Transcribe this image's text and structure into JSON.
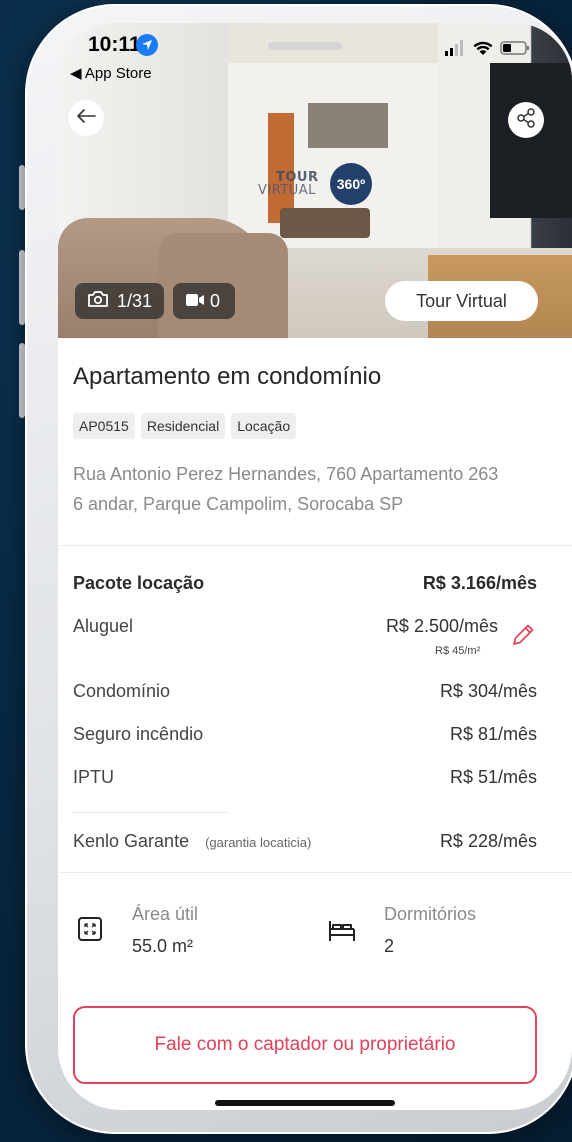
{
  "status_bar": {
    "time": "10:11",
    "back_app": "◀ App Store"
  },
  "hero": {
    "tour_logo_line1": "TOUR",
    "tour_logo_line2": "VIRTUAL",
    "tour_logo_badge": "360º",
    "photos_count": "1/31",
    "videos_count": "0",
    "tour_button": "Tour Virtual"
  },
  "listing": {
    "title": "Apartamento em condomínio",
    "tags": [
      "AP0515",
      "Residencial",
      "Locação"
    ],
    "address": "Rua Antonio Perez Hernandes, 760 Apartamento 263 6 andar, Parque Campolim, Sorocaba SP"
  },
  "pricing": {
    "package_label": "Pacote locação",
    "package_value": "R$ 3.166/mês",
    "rent_label": "Aluguel",
    "rent_value": "R$ 2.500/mês",
    "rent_per_m2": "R$ 45/m²",
    "condo_label": "Condomínio",
    "condo_value": "R$ 304/mês",
    "insurance_label": "Seguro incêndio",
    "insurance_value": "R$ 81/mês",
    "iptu_label": "IPTU",
    "iptu_value": "R$ 51/mês",
    "guarantee_label": "Kenlo Garante",
    "guarantee_note": "(garantia locaticia)",
    "guarantee_value": "R$ 228/mês"
  },
  "features": {
    "area_label": "Área útil",
    "area_value": "55.0 m²",
    "bedrooms_label": "Dormitórios",
    "bedrooms_value": "2"
  },
  "cta": {
    "contact_label": "Fale com o captador ou proprietário"
  },
  "colors": {
    "accent": "#e0415b",
    "background": "#082a45",
    "location_blue": "#1a7cf5"
  }
}
